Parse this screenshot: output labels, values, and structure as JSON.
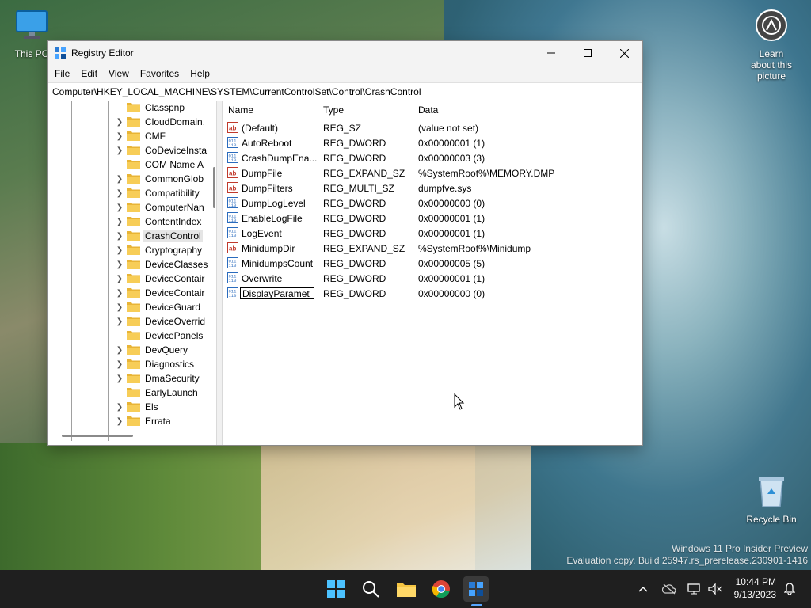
{
  "desktop": {
    "icons": [
      {
        "label": "This PC",
        "icon": "monitor-icon"
      },
      {
        "label": "Learn about this picture",
        "icon": "camera-info-icon"
      },
      {
        "label": "Recycle Bin",
        "icon": "recycle-bin-icon"
      }
    ],
    "watermark": {
      "line1": "Windows 11 Pro Insider Preview",
      "line2": "Evaluation copy. Build 25947.rs_prerelease.230901-1416"
    }
  },
  "window": {
    "title": "Registry Editor",
    "menu": [
      "File",
      "Edit",
      "View",
      "Favorites",
      "Help"
    ],
    "address": "Computer\\HKEY_LOCAL_MACHINE\\SYSTEM\\CurrentControlSet\\Control\\CrashControl"
  },
  "tree": {
    "items": [
      {
        "label": "Classpnp",
        "expandable": false
      },
      {
        "label": "CloudDomain.",
        "expandable": true
      },
      {
        "label": "CMF",
        "expandable": true
      },
      {
        "label": "CoDeviceInsta",
        "expandable": true
      },
      {
        "label": "COM Name A",
        "expandable": false
      },
      {
        "label": "CommonGlob",
        "expandable": true
      },
      {
        "label": "Compatibility",
        "expandable": true
      },
      {
        "label": "ComputerNan",
        "expandable": true
      },
      {
        "label": "ContentIndex",
        "expandable": true
      },
      {
        "label": "CrashControl",
        "expandable": true,
        "selected": true
      },
      {
        "label": "Cryptography",
        "expandable": true
      },
      {
        "label": "DeviceClasses",
        "expandable": true
      },
      {
        "label": "DeviceContair",
        "expandable": true
      },
      {
        "label": "DeviceContair",
        "expandable": true
      },
      {
        "label": "DeviceGuard",
        "expandable": true
      },
      {
        "label": "DeviceOverrid",
        "expandable": true
      },
      {
        "label": "DevicePanels",
        "expandable": false
      },
      {
        "label": "DevQuery",
        "expandable": true
      },
      {
        "label": "Diagnostics",
        "expandable": true
      },
      {
        "label": "DmaSecurity",
        "expandable": true
      },
      {
        "label": "EarlyLaunch",
        "expandable": false
      },
      {
        "label": "Els",
        "expandable": true
      },
      {
        "label": "Errata",
        "expandable": true
      }
    ]
  },
  "list": {
    "headers": {
      "name": "Name",
      "type": "Type",
      "data": "Data"
    },
    "rows": [
      {
        "name": "(Default)",
        "type": "REG_SZ",
        "data": "(value not set)",
        "kind": "string"
      },
      {
        "name": "AutoReboot",
        "type": "REG_DWORD",
        "data": "0x00000001 (1)",
        "kind": "binary"
      },
      {
        "name": "CrashDumpEna...",
        "type": "REG_DWORD",
        "data": "0x00000003 (3)",
        "kind": "binary"
      },
      {
        "name": "DumpFile",
        "type": "REG_EXPAND_SZ",
        "data": "%SystemRoot%\\MEMORY.DMP",
        "kind": "string"
      },
      {
        "name": "DumpFilters",
        "type": "REG_MULTI_SZ",
        "data": "dumpfve.sys",
        "kind": "string"
      },
      {
        "name": "DumpLogLevel",
        "type": "REG_DWORD",
        "data": "0x00000000 (0)",
        "kind": "binary"
      },
      {
        "name": "EnableLogFile",
        "type": "REG_DWORD",
        "data": "0x00000001 (1)",
        "kind": "binary"
      },
      {
        "name": "LogEvent",
        "type": "REG_DWORD",
        "data": "0x00000001 (1)",
        "kind": "binary"
      },
      {
        "name": "MinidumpDir",
        "type": "REG_EXPAND_SZ",
        "data": "%SystemRoot%\\Minidump",
        "kind": "string"
      },
      {
        "name": "MinidumpsCount",
        "type": "REG_DWORD",
        "data": "0x00000005 (5)",
        "kind": "binary"
      },
      {
        "name": "Overwrite",
        "type": "REG_DWORD",
        "data": "0x00000001 (1)",
        "kind": "binary"
      },
      {
        "name": "DisplayParamet",
        "type": "REG_DWORD",
        "data": "0x00000000 (0)",
        "kind": "binary",
        "editing": true
      }
    ]
  },
  "taskbar": {
    "apps": [
      "start-icon",
      "search-icon",
      "file-explorer-icon",
      "chrome-icon",
      "regedit-icon"
    ],
    "time": "10:44 PM",
    "date": "9/13/2023"
  },
  "colors": {
    "accent": "#0067c0",
    "taskbar": "#1f1f1f",
    "folder": "#f5c542"
  }
}
